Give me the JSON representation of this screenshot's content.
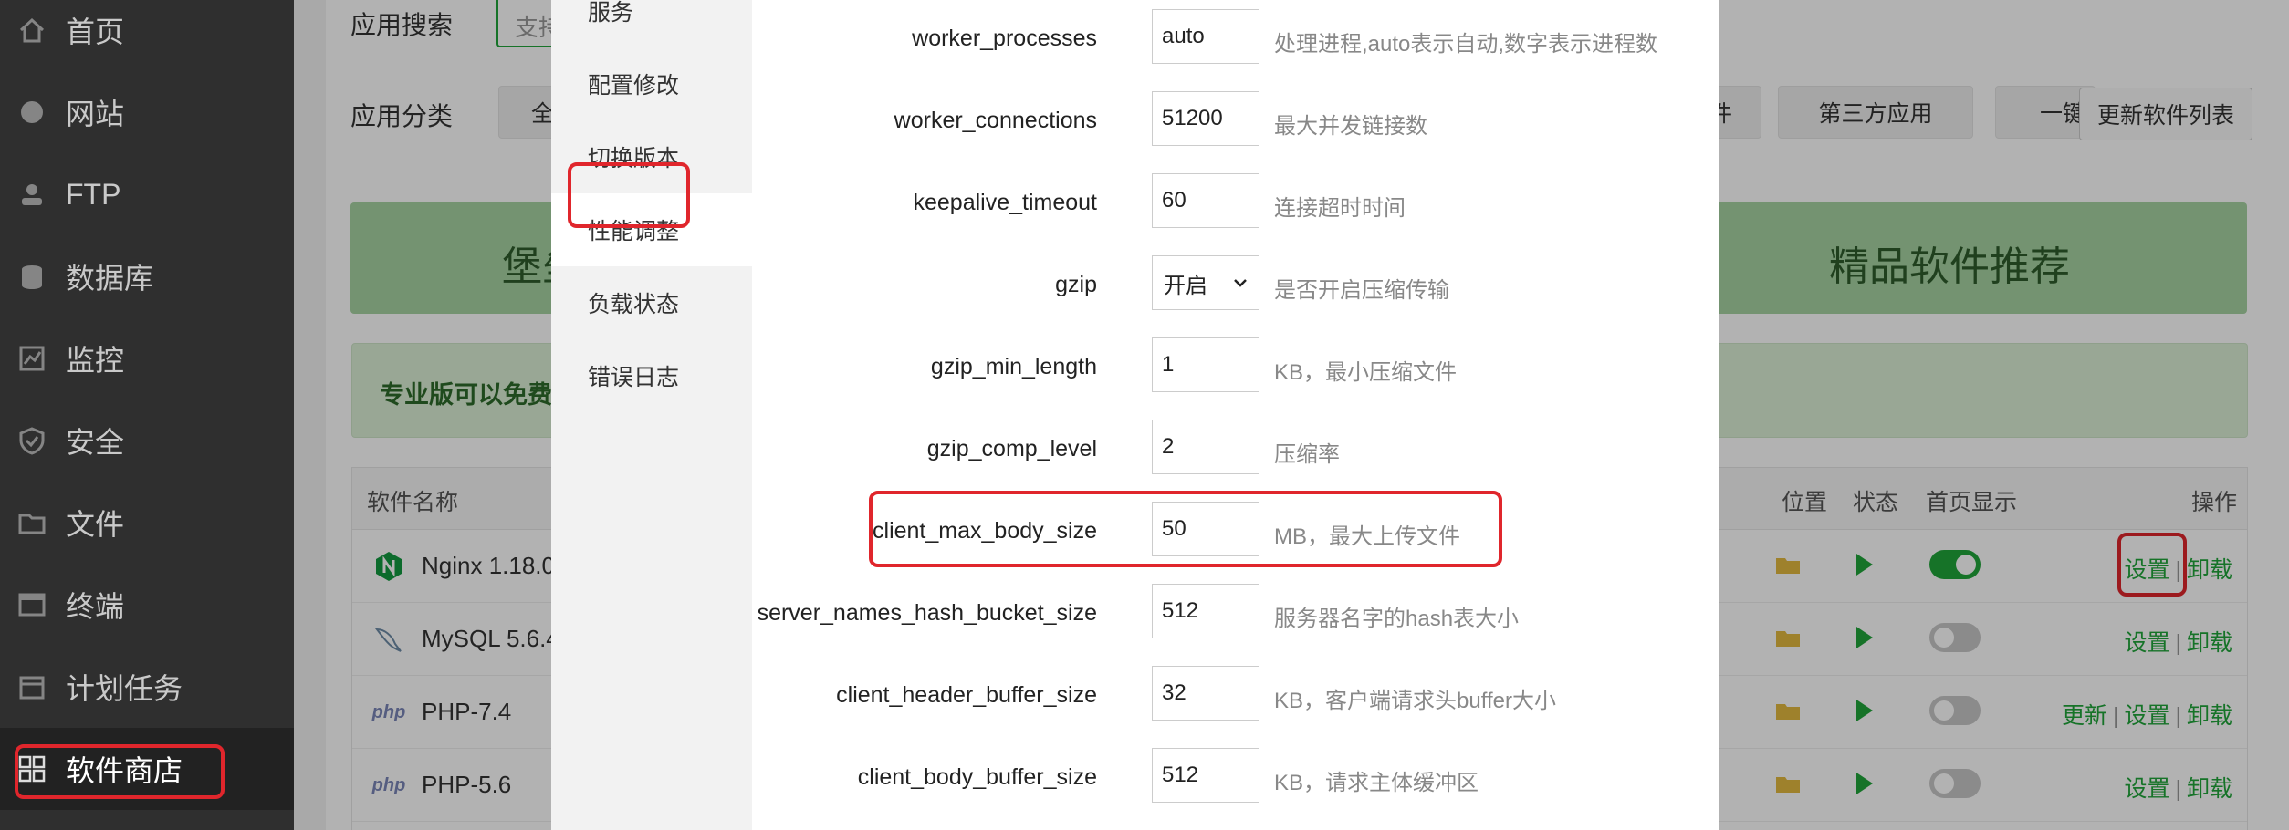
{
  "sidebar": {
    "items": [
      {
        "label": "首页",
        "icon": "home-icon"
      },
      {
        "label": "网站",
        "icon": "globe-icon"
      },
      {
        "label": "FTP",
        "icon": "ftp-user-icon"
      },
      {
        "label": "数据库",
        "icon": "database-icon"
      },
      {
        "label": "监控",
        "icon": "monitor-chart-icon"
      },
      {
        "label": "安全",
        "icon": "shield-icon"
      },
      {
        "label": "文件",
        "icon": "folder-icon"
      },
      {
        "label": "终端",
        "icon": "terminal-icon"
      },
      {
        "label": "计划任务",
        "icon": "calendar-icon"
      },
      {
        "label": "软件商店",
        "icon": "apps-grid-icon",
        "active": true
      }
    ]
  },
  "page": {
    "search_label": "应用搜索",
    "search_placeholder": "支持",
    "category_label": "应用分类",
    "categories_visible": [
      "全",
      "件",
      "第三方应用",
      "一键"
    ],
    "update_button": "更新软件列表",
    "banner_left": "堡垒",
    "banner_right": "精品软件推荐",
    "notice": "专业版可以免费使",
    "table": {
      "headers": {
        "name": "软件名称",
        "location": "位置",
        "status": "状态",
        "homepage": "首页显示",
        "actions": "操作"
      },
      "rows": [
        {
          "name": "Nginx 1.18.0",
          "icon": "nginx-logo-icon",
          "homepage": "on",
          "actions": [
            "设置",
            "卸载"
          ]
        },
        {
          "name": "MySQL 5.6.4",
          "icon": "mysql-dolphin-icon",
          "homepage": "off",
          "actions": [
            "设置",
            "卸载"
          ]
        },
        {
          "name": "PHP-7.4",
          "icon": "php-logo-icon",
          "homepage": "off",
          "actions": [
            "更新",
            "设置",
            "卸载"
          ]
        },
        {
          "name": "PHP-5.6",
          "icon": "php-logo-icon",
          "homepage": "off",
          "actions": [
            "设置",
            "卸载"
          ]
        }
      ],
      "php_logo_text": "php"
    }
  },
  "modal": {
    "nav": [
      "服务",
      "配置修改",
      "切换版本",
      "性能调整",
      "负载状态",
      "错误日志"
    ],
    "active_nav": "性能调整",
    "fields": [
      {
        "name": "worker_processes",
        "value": "auto",
        "hint": "处理进程,auto表示自动,数字表示进程数"
      },
      {
        "name": "worker_connections",
        "value": "51200",
        "hint": "最大并发链接数"
      },
      {
        "name": "keepalive_timeout",
        "value": "60",
        "hint": "连接超时时间"
      },
      {
        "name": "gzip",
        "value": "开启",
        "hint": "是否开启压缩传输",
        "type": "select"
      },
      {
        "name": "gzip_min_length",
        "value": "1",
        "hint": "KB，最小压缩文件"
      },
      {
        "name": "gzip_comp_level",
        "value": "2",
        "hint": "压缩率"
      },
      {
        "name": "client_max_body_size",
        "value": "50",
        "hint": "MB，最大上传文件"
      },
      {
        "name": "server_names_hash_bucket_size",
        "value": "512",
        "hint": "服务器名字的hash表大小"
      },
      {
        "name": "client_header_buffer_size",
        "value": "32",
        "hint": "KB，客户端请求头buffer大小"
      },
      {
        "name": "client_body_buffer_size",
        "value": "512",
        "hint": "KB，请求主体缓冲区"
      }
    ]
  },
  "colors": {
    "accent": "#20a53a",
    "highlight": "#e0262c",
    "sidebar_bg": "#2f2f2f"
  }
}
